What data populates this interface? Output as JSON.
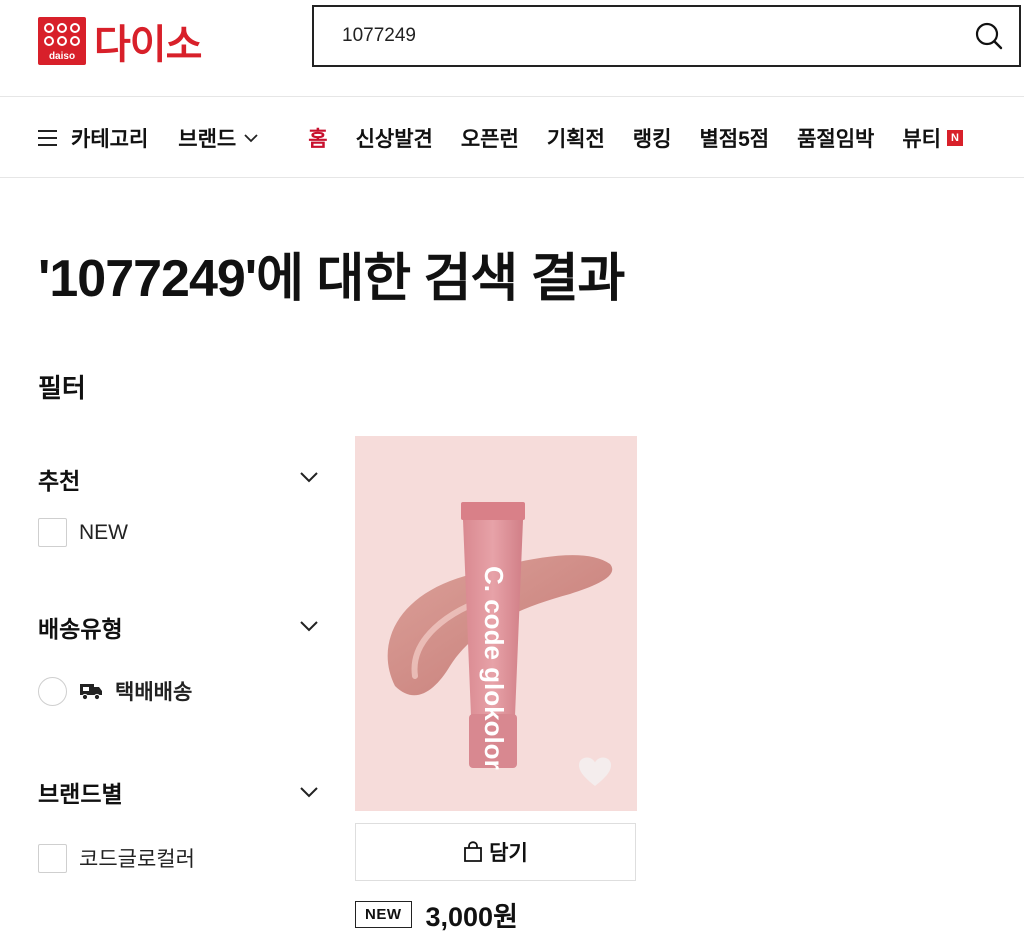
{
  "header": {
    "logo_text": "다이소",
    "logo_sub": "daiso",
    "search_value": "1077249",
    "search_icon": "search-icon"
  },
  "nav": {
    "category_label": "카테고리",
    "brand_label": "브랜드",
    "items": [
      {
        "label": "홈",
        "active": true
      },
      {
        "label": "신상발견"
      },
      {
        "label": "오픈런"
      },
      {
        "label": "기획전"
      },
      {
        "label": "랭킹"
      },
      {
        "label": "별점5점"
      },
      {
        "label": "품절임박"
      },
      {
        "label": "뷰티",
        "badge": "N"
      }
    ],
    "accent_color": "#c8102e"
  },
  "main": {
    "result_title": "'1077249'에 대한 검색 결과",
    "filter_title": "필터"
  },
  "filters": [
    {
      "title": "추천",
      "options": [
        {
          "label": "NEW",
          "type": "checkbox"
        }
      ]
    },
    {
      "title": "배송유형",
      "options": [
        {
          "label": "택배배송",
          "type": "radio",
          "icon": "truck-icon"
        }
      ]
    },
    {
      "title": "브랜드별",
      "options": [
        {
          "label": "코드글로컬러",
          "type": "checkbox"
        }
      ]
    }
  ],
  "product": {
    "image_label": "C. code glokolor",
    "cart_label": "담기",
    "badge": "NEW",
    "price": "3,000원"
  },
  "colors": {
    "brand_red": "#d8202a",
    "product_bg": "#f6dcda"
  }
}
